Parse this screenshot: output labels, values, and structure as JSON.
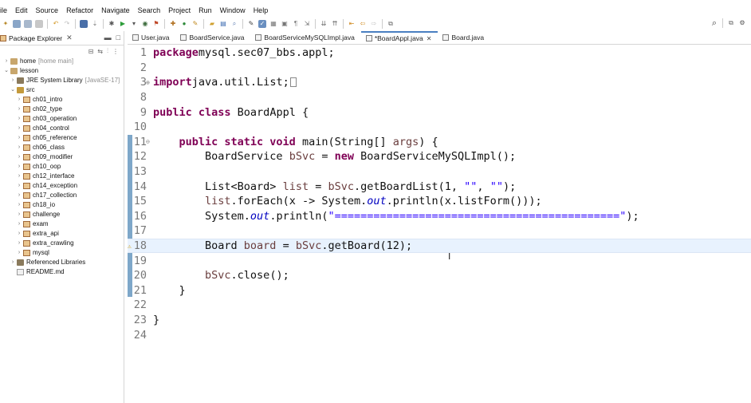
{
  "menu": [
    "ile",
    "Edit",
    "Source",
    "Refactor",
    "Navigate",
    "Search",
    "Project",
    "Run",
    "Window",
    "Help"
  ],
  "package_explorer": {
    "title": "Package Explorer",
    "tree": [
      {
        "label": "home",
        "deco": "[home main]",
        "arrow": ">",
        "icon": "project",
        "indent": 0
      },
      {
        "label": "lesson",
        "deco": "",
        "arrow": "v",
        "icon": "project",
        "indent": 0
      },
      {
        "label": "JRE System Library",
        "deco": "[JavaSE-17]",
        "arrow": ">",
        "icon": "lib",
        "indent": 1
      },
      {
        "label": "src",
        "deco": "",
        "arrow": "v",
        "icon": "src",
        "indent": 1
      },
      {
        "label": "ch01_intro",
        "deco": "",
        "arrow": ">",
        "icon": "pkg",
        "indent": 2
      },
      {
        "label": "ch02_type",
        "deco": "",
        "arrow": ">",
        "icon": "pkg",
        "indent": 2
      },
      {
        "label": "ch03_operation",
        "deco": "",
        "arrow": ">",
        "icon": "pkg",
        "indent": 2
      },
      {
        "label": "ch04_control",
        "deco": "",
        "arrow": ">",
        "icon": "pkg",
        "indent": 2
      },
      {
        "label": "ch05_reference",
        "deco": "",
        "arrow": ">",
        "icon": "pkg",
        "indent": 2
      },
      {
        "label": "ch06_class",
        "deco": "",
        "arrow": ">",
        "icon": "pkg",
        "indent": 2
      },
      {
        "label": "ch09_modifier",
        "deco": "",
        "arrow": ">",
        "icon": "pkg",
        "indent": 2
      },
      {
        "label": "ch10_oop",
        "deco": "",
        "arrow": ">",
        "icon": "pkg",
        "indent": 2
      },
      {
        "label": "ch12_interface",
        "deco": "",
        "arrow": ">",
        "icon": "pkg",
        "indent": 2
      },
      {
        "label": "ch14_exception",
        "deco": "",
        "arrow": ">",
        "icon": "pkg",
        "indent": 2
      },
      {
        "label": "ch17_collection",
        "deco": "",
        "arrow": ">",
        "icon": "pkg",
        "indent": 2
      },
      {
        "label": "ch18_io",
        "deco": "",
        "arrow": ">",
        "icon": "pkg",
        "indent": 2
      },
      {
        "label": "challenge",
        "deco": "",
        "arrow": ">",
        "icon": "pkg",
        "indent": 2
      },
      {
        "label": "exam",
        "deco": "",
        "arrow": ">",
        "icon": "pkg",
        "indent": 2
      },
      {
        "label": "extra_api",
        "deco": "",
        "arrow": ">",
        "icon": "pkg",
        "indent": 2
      },
      {
        "label": "extra_crawling",
        "deco": "",
        "arrow": ">",
        "icon": "pkg",
        "indent": 2
      },
      {
        "label": "mysql",
        "deco": "",
        "arrow": ">",
        "icon": "pkg",
        "indent": 2
      },
      {
        "label": "Referenced Libraries",
        "deco": "",
        "arrow": ">",
        "icon": "lib",
        "indent": 1
      },
      {
        "label": "README.md",
        "deco": "",
        "arrow": "",
        "icon": "file",
        "indent": 1
      }
    ]
  },
  "editor_tabs": [
    {
      "label": "User.java",
      "active": false
    },
    {
      "label": "BoardService.java",
      "active": false
    },
    {
      "label": "BoardServiceMySQLImpl.java",
      "active": false
    },
    {
      "label": "*BoardAppl.java",
      "active": true
    },
    {
      "label": "Board.java",
      "active": false
    }
  ],
  "code": [
    {
      "n": "1",
      "segs": [
        [
          "kw",
          "package"
        ],
        [
          "",
          "mysql.sec07_bbs.appl;"
        ]
      ]
    },
    {
      "n": "2",
      "segs": []
    },
    {
      "n": "3",
      "fold": "⊕",
      "segs": [
        [
          "kw",
          "import"
        ],
        [
          "",
          "java.util.List;"
        ],
        [
          "box",
          ""
        ]
      ]
    },
    {
      "n": "8",
      "segs": []
    },
    {
      "n": "9",
      "segs": [
        [
          "kw",
          "public class"
        ],
        [
          "",
          " BoardAppl {"
        ]
      ]
    },
    {
      "n": "10",
      "segs": []
    },
    {
      "n": "11",
      "fold": "⊖",
      "segs": [
        [
          "",
          "    "
        ],
        [
          "kw",
          "public static void"
        ],
        [
          "",
          " main(String[] "
        ],
        [
          "var",
          "args"
        ],
        [
          "",
          ") {"
        ]
      ]
    },
    {
      "n": "12",
      "segs": [
        [
          "",
          "        BoardService "
        ],
        [
          "var",
          "bSvc"
        ],
        [
          "",
          " = "
        ],
        [
          "kw",
          "new"
        ],
        [
          "",
          " BoardServiceMySQLImpl();"
        ]
      ]
    },
    {
      "n": "13",
      "segs": []
    },
    {
      "n": "14",
      "segs": [
        [
          "",
          "        List<Board> "
        ],
        [
          "var",
          "list"
        ],
        [
          "",
          " = "
        ],
        [
          "var",
          "bSvc"
        ],
        [
          "",
          ".getBoardList(1, "
        ],
        [
          "str",
          "\"\""
        ],
        [
          "",
          ", "
        ],
        [
          "str",
          "\"\""
        ],
        [
          "",
          ");"
        ]
      ]
    },
    {
      "n": "15",
      "segs": [
        [
          "",
          "        "
        ],
        [
          "var",
          "list"
        ],
        [
          "",
          ".forEach(x -> System."
        ],
        [
          "stat",
          "out"
        ],
        [
          "",
          ".println(x.listForm()));"
        ]
      ]
    },
    {
      "n": "16",
      "segs": [
        [
          "",
          "        System."
        ],
        [
          "stat",
          "out"
        ],
        [
          "",
          ".println("
        ],
        [
          "str",
          "\"============================================\""
        ],
        [
          "",
          ");"
        ]
      ]
    },
    {
      "n": "17",
      "segs": []
    },
    {
      "n": "18",
      "highlight": true,
      "warn": true,
      "segs": [
        [
          "",
          "        Board "
        ],
        [
          "var",
          "board"
        ],
        [
          "",
          " = "
        ],
        [
          "var",
          "bSvc"
        ],
        [
          "",
          ".getBoard(12);"
        ]
      ]
    },
    {
      "n": "19",
      "segs": []
    },
    {
      "n": "20",
      "segs": [
        [
          "",
          "        "
        ],
        [
          "var",
          "bSvc"
        ],
        [
          "",
          ".close();"
        ]
      ]
    },
    {
      "n": "21",
      "segs": [
        [
          "",
          "    }"
        ]
      ]
    },
    {
      "n": "22",
      "segs": []
    },
    {
      "n": "23",
      "segs": [
        [
          "",
          "}"
        ]
      ]
    },
    {
      "n": "24",
      "segs": []
    }
  ],
  "icons": {
    "search": "search-icon",
    "perspective": "perspective-icon",
    "java_perspective": "java-perspective-icon"
  }
}
